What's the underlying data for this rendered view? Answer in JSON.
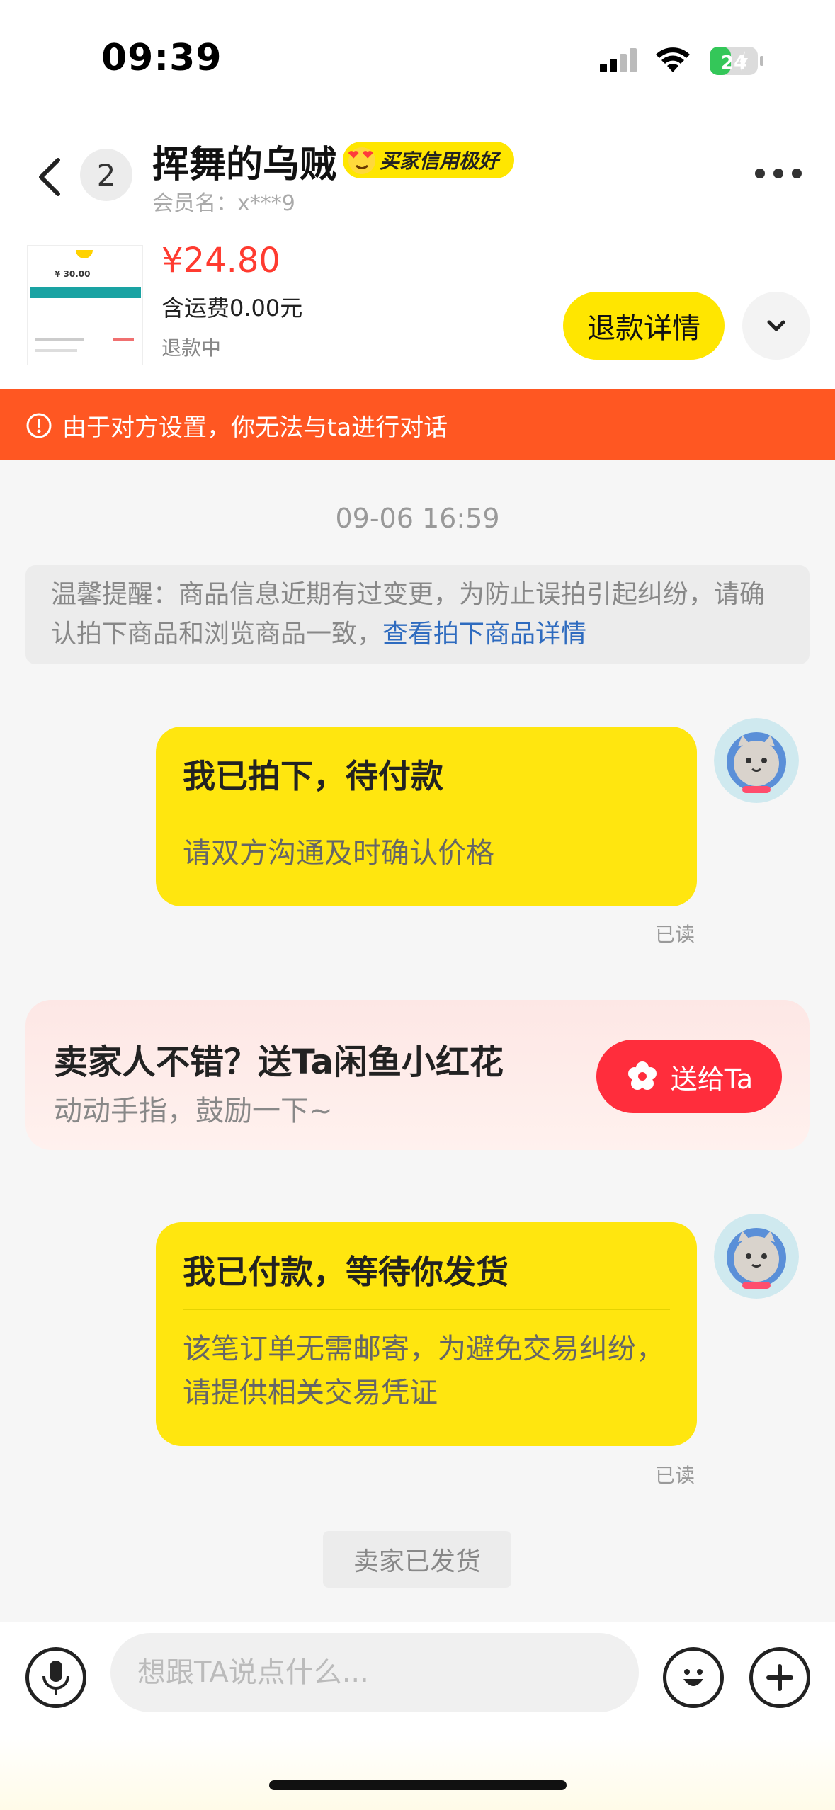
{
  "status_bar": {
    "time": "09:39",
    "battery": "24"
  },
  "header": {
    "unread_count": "2",
    "chat_name": "挥舞的乌贼",
    "credit_badge": "买家信用极好",
    "member_name": "会员名：x***9"
  },
  "product": {
    "price": "¥24.80",
    "shipping": "含运费0.00元",
    "status": "退款中",
    "refund_button": "退款详情",
    "thumb_amount": "¥ 30.00"
  },
  "warning": "由于对方设置，你无法与ta进行对话",
  "chat": {
    "timestamp": "09-06 16:59",
    "tip_text": "温馨提醒：商品信息近期有过变更，为防止误拍引起纠纷，请确认拍下商品和浏览商品一致，",
    "tip_link": "查看拍下商品详情",
    "messages": [
      {
        "title": "我已拍下，待付款",
        "body": "请双方沟通及时确认价格",
        "read": "已读"
      },
      {
        "title": "我已付款，等待你发货",
        "body": "该笔订单无需邮寄，为避免交易纠纷，请提供相关交易凭证",
        "read": "已读"
      }
    ],
    "flower_card": {
      "title": "卖家人不错？送Ta闲鱼小红花",
      "subtitle": "动动手指，鼓励一下~",
      "button": "送给Ta"
    },
    "shipped_tag": "卖家已发货"
  },
  "input": {
    "placeholder": "想跟TA说点什么..."
  },
  "colors": {
    "accent_yellow": "#ffe600",
    "warning_orange": "#ff5722",
    "price_red": "#ff3b30",
    "link_blue": "#2e6bbf"
  }
}
